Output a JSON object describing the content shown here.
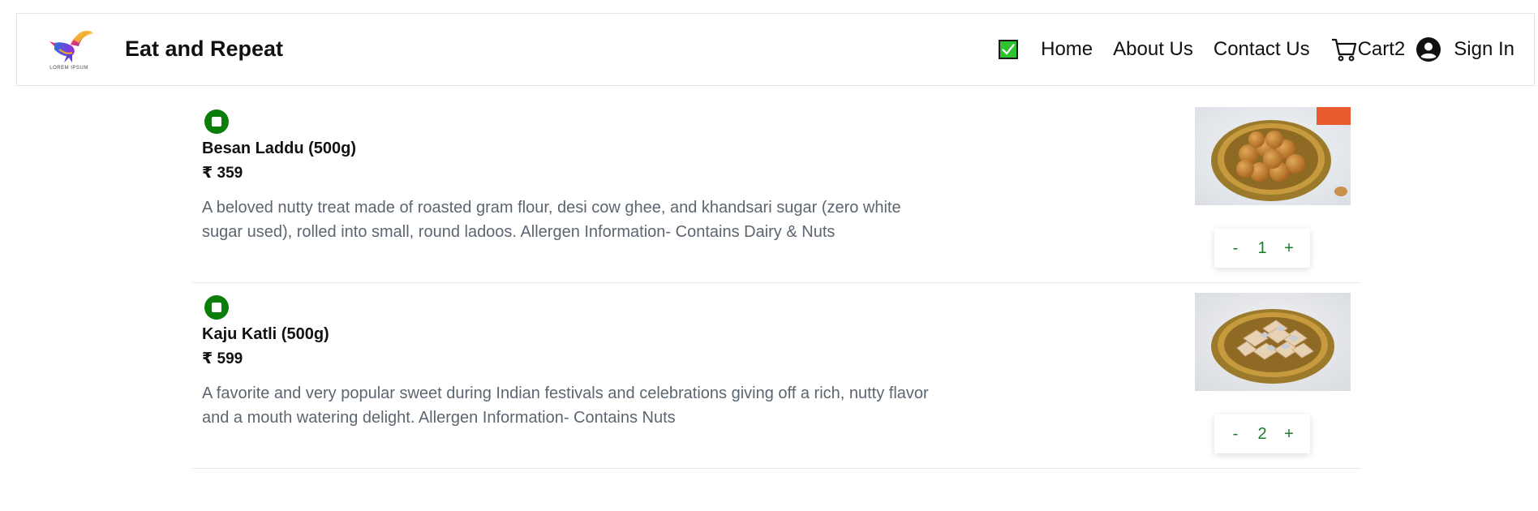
{
  "header": {
    "brand": "Eat and Repeat",
    "logo_text": "LOREM IPSUM",
    "veg_toggle_checked": true,
    "nav": {
      "home": "Home",
      "about": "About Us",
      "contact": "Contact Us",
      "cart": "Cart2",
      "signin": "Sign In"
    }
  },
  "items": [
    {
      "name": "Besan Laddu (500g)",
      "price": "₹ 359",
      "description": "A beloved nutty treat made of roasted gram flour, desi cow ghee, and khandsari sugar (zero white sugar used), rolled into small, round ladoos. Allergen Information- Contains Dairy & Nuts",
      "qty": "1",
      "minus": "-",
      "plus": "+"
    },
    {
      "name": "Kaju Katli (500g)",
      "price": "₹ 599",
      "description": "A favorite and very popular sweet during Indian festivals and celebrations giving off a rich, nutty flavor and a mouth watering delight. Allergen Information- Contains Nuts",
      "qty": "2",
      "minus": "-",
      "plus": "+"
    }
  ],
  "colors": {
    "veg_green": "#0b7d0b",
    "toggle_green": "#2ec32e",
    "stepper_text": "#1c7a2a",
    "desc_text": "#5c6670"
  },
  "icons": [
    "bird-logo-icon",
    "checkbox-icon",
    "cart-icon",
    "user-circle-icon",
    "veg-indicator-icon"
  ]
}
